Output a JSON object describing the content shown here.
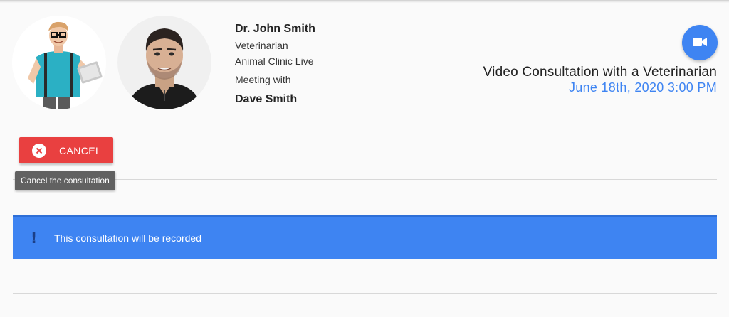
{
  "doctor": {
    "name": "Dr. John Smith",
    "role": "Veterinarian",
    "clinic": "Animal Clinic Live"
  },
  "meeting": {
    "label": "Meeting with",
    "patient": "Dave Smith"
  },
  "consultation": {
    "title": "Video Consultation with a Veterinarian",
    "datetime": "June 18th, 2020 3:00 PM"
  },
  "actions": {
    "cancel_label": "CANCEL",
    "cancel_tooltip": "Cancel the consultation",
    "video_icon": "videocam-icon"
  },
  "alert": {
    "icon": "!",
    "message": "This consultation will be recorded"
  },
  "colors": {
    "primary": "#3e84f2",
    "danger": "#e94040",
    "tooltip": "#616161"
  }
}
